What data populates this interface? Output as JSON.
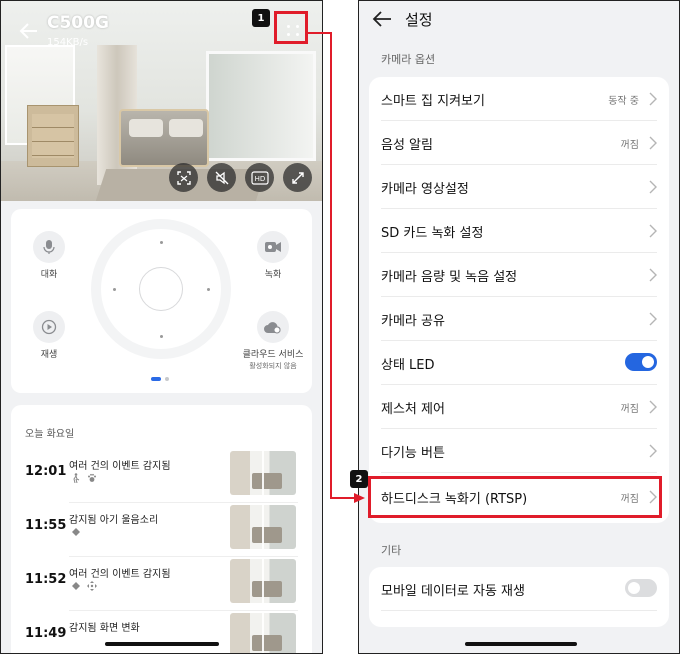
{
  "left": {
    "camera": {
      "title": "C500G",
      "bitrate": "154KB/s"
    },
    "video_buttons": [
      "screenshot-icon",
      "mute-icon",
      "hd-icon",
      "fullscreen-icon"
    ],
    "hd_label": "HD",
    "controls": {
      "talk": "대화",
      "record": "녹화",
      "playback": "재생",
      "cloud": "클라우드 서비스",
      "cloud_sub": "활성화되지 않음"
    },
    "events": {
      "header": "오늘 화요일",
      "rows": [
        {
          "time": "12:01",
          "title": "여러 건의 이벤트 감지됨",
          "icons": [
            "person-icon",
            "pet-icon"
          ]
        },
        {
          "time": "11:55",
          "title": "감지됨 아기 울음소리",
          "icons": [
            "sound-icon"
          ]
        },
        {
          "time": "11:52",
          "title": "여러 건의 이벤트 감지됨",
          "icons": [
            "sound-icon",
            "move-icon"
          ]
        },
        {
          "time": "11:49",
          "title": "감지됨 화면 변화",
          "icons": []
        }
      ]
    }
  },
  "right": {
    "title": "설정",
    "section_camera": "카메라 옵션",
    "section_other": "기타",
    "accent": "#2466e0",
    "items": [
      {
        "label": "스마트 집 지켜보기",
        "value": "동작 중"
      },
      {
        "label": "음성 알림",
        "value": "꺼짐"
      },
      {
        "label": "카메라 영상설정",
        "value": ""
      },
      {
        "label": "SD 카드 녹화 설정",
        "value": ""
      },
      {
        "label": "카메라 음량 및 녹음 설정",
        "value": ""
      },
      {
        "label": "카메라 공유",
        "value": ""
      },
      {
        "label": "상태 LED",
        "value": "",
        "toggle": true
      },
      {
        "label": "제스처 제어",
        "value": "꺼짐"
      },
      {
        "label": "다기능 버튼",
        "value": ""
      },
      {
        "label": "하드디스크 녹화기 (RTSP)",
        "value": "꺼짐"
      }
    ],
    "other_items": [
      {
        "label": "모바일 데이터로 자동 재생",
        "toggle": false
      }
    ]
  },
  "callouts": {
    "step1": "1",
    "step2": "2",
    "highlight": "#e01c2a"
  }
}
